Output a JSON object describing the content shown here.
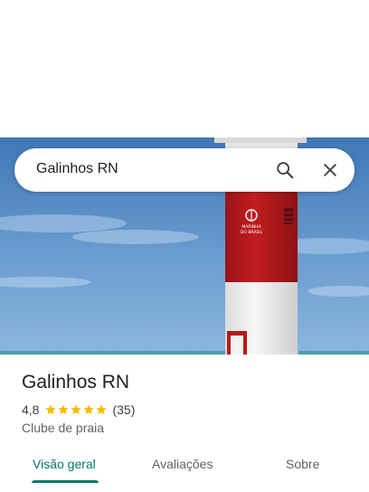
{
  "search": {
    "query": "Galinhos RN"
  },
  "icons": {
    "search": "search-icon",
    "close": "close-icon",
    "star": "star-icon"
  },
  "hero_image": {
    "lighthouse_text_1": "MARINHA",
    "lighthouse_text_2": "DO BRASIL"
  },
  "place": {
    "title": "Galinhos RN",
    "rating": "4,8",
    "stars": 5,
    "review_count": "(35)",
    "category": "Clube de praia"
  },
  "tabs": [
    {
      "label": "Visão geral",
      "active": true
    },
    {
      "label": "Avaliações",
      "active": false
    },
    {
      "label": "Sobre",
      "active": false
    }
  ],
  "colors": {
    "accent": "#00796b",
    "star": "#fbbc04",
    "sky": "#5b8fc9",
    "lighthouse_red": "#b5191c"
  }
}
